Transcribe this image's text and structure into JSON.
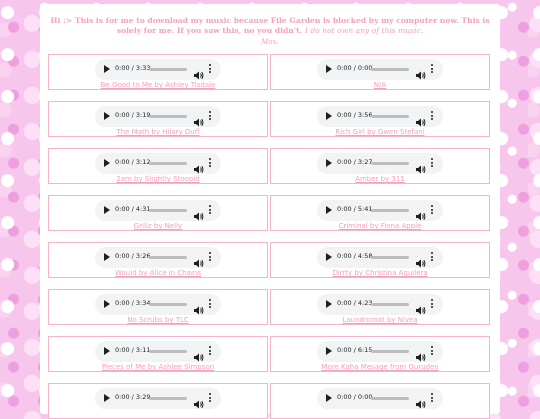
{
  "intro": {
    "text": "Hi :> This is for me to download my music because File Garden is blocked by my computer now. This is solely for me. If you saw this, no you didn't.",
    "note": "I do not own any of this music.",
    "signature": "Mox."
  },
  "tracks": [
    {
      "time": "0:00 / 3:33",
      "title": "Be Good to Me by Ashley Tisdale"
    },
    {
      "time": "0:00 / 0:00",
      "title": "N/A"
    },
    {
      "time": "0:00 / 3:19",
      "title": "The Math by Hilary Duff"
    },
    {
      "time": "0:00 / 3:56",
      "title": "Rich Girl by Gwen Stefani"
    },
    {
      "time": "0:00 / 3:12",
      "title": "2am by Slightly Stoopid"
    },
    {
      "time": "0:00 / 3:27",
      "title": "Amber by 311"
    },
    {
      "time": "0:00 / 4:31",
      "title": "Grillz by Nelly"
    },
    {
      "time": "0:00 / 5:41",
      "title": "Criminal by Fiona Apple"
    },
    {
      "time": "0:00 / 3:26",
      "title": "Would by Alice in Chains"
    },
    {
      "time": "0:00 / 4:58",
      "title": "Dirrty by Christina Aguilera"
    },
    {
      "time": "0:00 / 3:34",
      "title": "No Scrubs by TLC"
    },
    {
      "time": "0:00 / 4:23",
      "title": "Laundromat by Nivea"
    },
    {
      "time": "0:00 / 3:11",
      "title": "Pieces of Me by Ashlee Simpson"
    },
    {
      "time": "0:00 / 6:15",
      "title": "More Kaha Mesage from Gurudev"
    },
    {
      "time": "0:00 / 3:29",
      "title": ""
    },
    {
      "time": "0:00 / 0:00",
      "title": ""
    }
  ],
  "colors": {
    "accent": "#f6a0bc",
    "border": "#f6b4cc",
    "player_bg": "#f1f3f4"
  },
  "icons": {
    "play": "play-icon",
    "volume": "volume-icon",
    "more": "more-options-icon"
  }
}
